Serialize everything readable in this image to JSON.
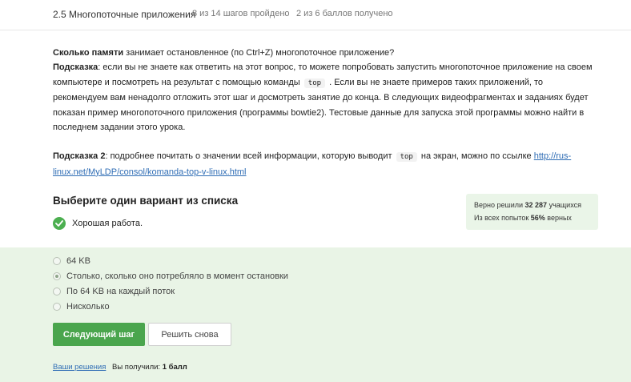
{
  "header": {
    "title": "2.5 Многопоточные приложения",
    "steps": "8 из 14 шагов пройдено",
    "score": "2 из 6 баллов  получено"
  },
  "question": {
    "bold1": "Сколько памяти",
    "text1": " занимает остановленное (по Ctrl+Z) многопоточное приложение?",
    "hint_label": "Подсказка",
    "hint_text_a": ": если вы не знаете как ответить на этот вопрос, то можете попробовать запустить многопоточное приложение на своем компьютере и посмотреть на результат с помощью команды",
    "hint_code": "top",
    "hint_text_b": ". Если вы не знаете примеров таких приложений, то рекомендуем вам ненадолго отложить этот шаг и досмотреть занятие до конца. В следующих видеофрагментах и заданиях будет показан пример многопоточного приложения (программы bowtie2). Тестовые данные для запуска этой программы можно найти в последнем задании этого урока.",
    "hint2_label": "Подсказка 2",
    "hint2_text_a": ": подробнее почитать о значении всей информации, которую выводит",
    "hint2_code": "top",
    "hint2_text_b": "на экран, можно по ссылке",
    "hint2_link": "http://rus-linux.net/MyLDP/consol/komanda-top-v-linux.html"
  },
  "quiz": {
    "prompt": "Выберите один вариант из списка",
    "feedback": "Хорошая работа.",
    "options": [
      "64 KB",
      "Столько, сколько оно потребляло в момент остановки",
      "По 64 KB на каждый поток",
      "Нисколько"
    ],
    "selected_index": 1
  },
  "stats": {
    "solved_prefix": "Верно решили ",
    "solved_count": "32 287",
    "solved_suffix": " учащихся",
    "attempts_prefix": "Из всех попыток ",
    "attempts_percent": "56%",
    "attempts_suffix": " верных"
  },
  "buttons": {
    "next": "Следующий шаг",
    "retry": "Решить снова"
  },
  "footer": {
    "solutions_link": "Ваши решения",
    "earned_prefix": "Вы получили: ",
    "earned_value": "1 балл"
  },
  "colors": {
    "accent_green": "#4aa54d",
    "panel_bg": "#e9f4e6",
    "link": "#2f6db5"
  }
}
